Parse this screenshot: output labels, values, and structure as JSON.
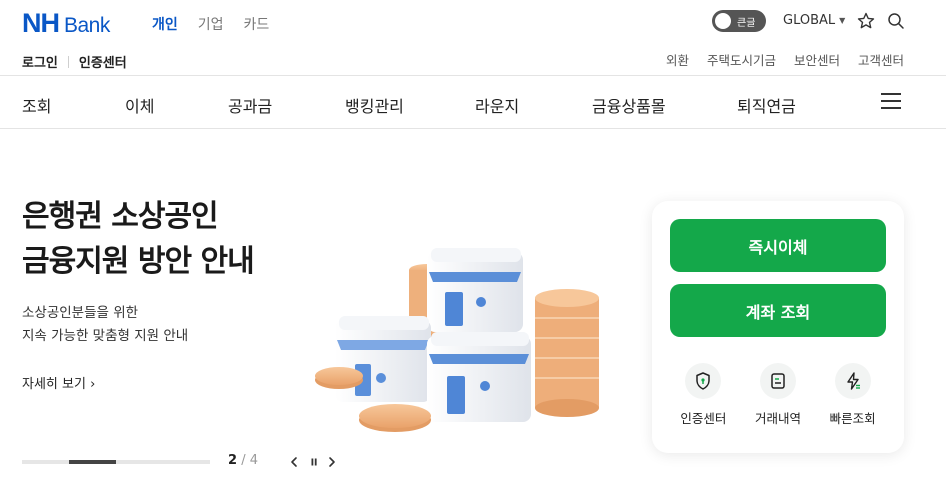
{
  "brand": {
    "logo_main": "NH",
    "logo_sub": "Bank"
  },
  "segments": [
    {
      "label": "개인",
      "active": true
    },
    {
      "label": "기업",
      "active": false
    },
    {
      "label": "카드",
      "active": false
    }
  ],
  "header": {
    "contrast_toggle_label": "큰글",
    "global_label": "GLOBAL",
    "favorite_icon": "star-icon",
    "search_icon": "search-icon"
  },
  "account_links": {
    "login": "로그인",
    "cert_center": "인증센터"
  },
  "util_links": [
    "외환",
    "주택도시기금",
    "보안센터",
    "고객센터"
  ],
  "main_nav": [
    "조회",
    "이체",
    "공과금",
    "뱅킹관리",
    "라운지",
    "금융상품몰",
    "퇴직연금"
  ],
  "hero": {
    "title_line1": "은행권 소상공인",
    "title_line2": "금융지원 방안 안내",
    "subtitle_line1": "소상공인분들을 위한",
    "subtitle_line2": "지속 가능한 맞춤형 지원 안내",
    "more_label": "자세히 보기",
    "slide_current": "2",
    "slide_total": "4",
    "slide_progress": 0.5
  },
  "quick": {
    "instant_transfer": "즉시이체",
    "account_inquiry": "계좌 조회",
    "icons": [
      {
        "label": "인증센터",
        "icon": "shield-icon"
      },
      {
        "label": "거래내역",
        "icon": "receipt-icon"
      },
      {
        "label": "빠른조회",
        "icon": "lightning-icon"
      }
    ]
  },
  "colors": {
    "brand_blue": "#0a57c6",
    "action_green": "#14a84a"
  }
}
